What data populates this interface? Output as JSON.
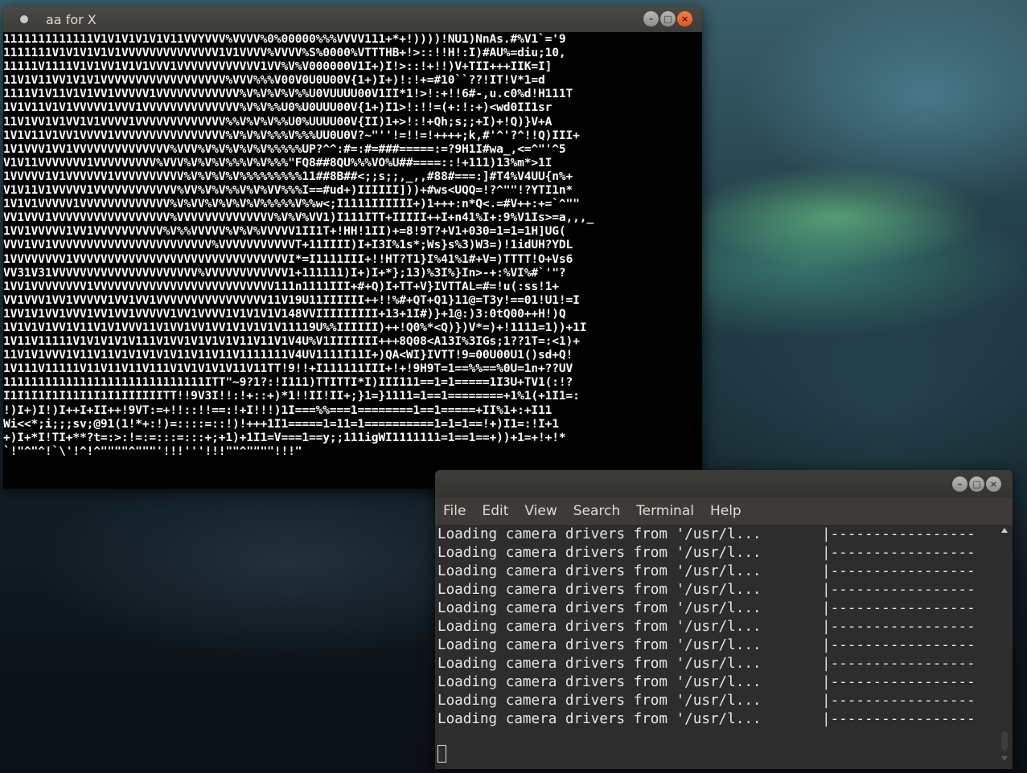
{
  "aa_window": {
    "title": "aa for X",
    "lines": [
      "1111111111111V1V1V1V1V1V11VVYVVV%VVVV%0%00000%%%VVVV111+*+!))))!NU1)NnAs.#%V1`='9",
      "1111111V1V1V1V1V1VVVVVVVVVVVVVV1V1VVVV%VVVV%S%0000%VTTTHB+!>::!!H!:I)#AU%=diu;10,",
      "11111V1111V1V1VV1V1V1VVV1VVVVVVVVVVVV1VV%V%V000000V1I+)I!>::!+!!)V+TII+++IIK=I]",
      "11V1V11VV1V1V1VVVVVVVVVVVVVVVVVV%VVV%%%V00V0U0U00V{1+)I+)!:!+=#10``??!IT!V*1=d",
      "1111V1V11V1V1VV1VVVVV1VVVVVVVVVVVV%V%V%V%V%%U0VUUUU00V1II*1!>!:+!!6#-,u.c0%d!H111T",
      "1V1V11V1V1VVVVV1VVV1VVVVVVVVVVVVVV%V%V%%U0%U0UUU00V{1+)I1>!:!!=(+:!:+)<wd0II1sr",
      "11V1VV1V1VV1V1VVVV1VVVVVVVVVVVVV%%V%V%V%%U0%UUUU00V{II)1+>!:!+Qh;s;;+I)+!Q)}V+A",
      "1V1V11V1VV1VVVV1VVVVVVVVVVVVVVVV%V%V%V%%%V%%%UU0U0V?~\"''!=!!=!++++;k,#'^'?^!!Q)III+",
      "1V1VVV1VV1VVVVVVVVVVVVVV%VVV%V%V%V%V%V%%%%%UP?^^:#=:#=###=====:=?9H1I#wa_,<=^\"'^5",
      "V1V11VVVVVVV1VVVVVVVVV%VVV%V%V%V%%%V%V%%%\"FQ8##8QU%%%VO%U##====::!+111)13%m*>1I",
      "1VVVVV1V1VVVVVV1VVVVVVVVVV%V%V%V%V%%%%%%%%%11##8B##<;;s;;,_,,#88#===:]#T4%V4UU{n%+",
      "V1V11V1VVVVV1VVVVVVVVVVVV%VV%V%V%%V%V%VV%%%I==#ud+)IIIIII]))+#ws<UQQ=!?^\"\"!?YTI1n*",
      "1V1V1VVVVV1VVVVVVVVVVVVV%V%VV%V%V%V%V%%%%%V%%w<;I1111IIIIII+)1+++:n*Q<.=#V++:+=`^\"\"",
      "VV1VVV1VVVVVVVVVVVVVVVVV%VVVVVVVVVVVVVV%V%V%VV1)I111ITT+IIIII++I+n41%I+:9%V1Is>=a,,,_",
      "1VV1VVVVV1VV1VVVVVVVVVV%V%%VVVVV%V%V%VVVVV1II1T+!HH!1II)+=8!9T?+V1+030=1=1=1H]UG(",
      "VVV1VV1VVVVVVVVVVVVVVVVVVVVVVV%VVVVVVVVVVVT+11IIII)I+I3I%1s*;Ws}s%3)W3=)!1idUH?YDL",
      "1VVVVVVVV1VVVVVVVVVVVVVVVVVVVVVVVVVVVVVVVI*=I1111III+!!HT?T1}I%41%1#+V=)TTTT!O+Vs6",
      "VV31V31VVVVVVVVVVVVVVVVVVVVV%VVVVVVVVVVVV1+111111)I+)I+*};13)%3I%}In>-+:%VI%#`'\"?",
      "1VV1VVVVVVVV1VVVVVVVVVVVVVVVVVVVVVVVVVV111n1111III+#+Q)I+TT+V}IVTTAL=#=!u(:ss!1+",
      "VV1VVV1VV1VVVVV1VV1VV1VVVVVVVVVVVVVVVV11V19U11IIIIII++!!%#+QT+Q1}11@=T3y!==01!U1!=I",
      "1VV1V1VV1VVV1VV1VV1VVVVV1VV1VVVV1V1V1V1V148VVIIIIIIIII+13+1I#)}+1@:)3:0tQ00++H!)Q",
      "1V1V1V1VV1V11V1V1VVV11V1VV1VV1VV1V1V1V1V11119U%%IIIIII)++!Q0%*<Q)})V*=)+!1111=1))+1I",
      "1V11V11111V1V1V1V1V111V1VV1V1V1V1V11V11V1V4U%V1IIIIIII+++8Q08<A13I%3IGs;1??1T=:<1)+",
      "11V1V1VVV1V11V11V1V1V1V1V11V11V11V1111111V4UV1111I11I+)QA<WI}IVTT!9=00U00U1()sd+Q!",
      "1V111V11111V11V11V11V111V1V1V1V1V11V11TT!9!!+I111111III+!+!9H9T=1==%%==%0U=1n+??UV",
      "11111111111111111111111111111ITT\"~9?1?:!I111)TTITTI*I)III111==1=1=====1I3U+TV1(:!?",
      "I1I1I1I1I11I1I1I1IIIIIITT!!9V3I!!:!+::+)*1!!II!II+;}1=}1111=1==1========+1%1(+1I1=:",
      "!)I+)I!)I++I+II++!9VT:=+!!::!!==:!+I!!!)1I===%%===1========1==1=====+II%1+:+I11",
      "Wi<<*;i;;;sv;@91(1!*+:!)=::::=::!)!+++1I1=====1=11=1==========1=1=1==!+)I1=:!I+1",
      "+)I+*I!TI+**?t=:>:!=:=:::=:::+;+1)+1I1=V===1==y;;111igWI1111111=1==1==+))+1=+!+!*",
      "`!\"^\"^!`\\'!^!^\"\"\"\"^\"\"\"'!!!'''!!!\"\"^\"\"\"\"!!!\""
    ]
  },
  "terminal": {
    "title": "",
    "menu": [
      "File",
      "Edit",
      "View",
      "Search",
      "Terminal",
      "Help"
    ],
    "lines": [
      {
        "text": "Loading camera drivers from '/usr/l...",
        "bar": "|-----------------"
      },
      {
        "text": "Loading camera drivers from '/usr/l...",
        "bar": "|-----------------"
      },
      {
        "text": "Loading camera drivers from '/usr/l...",
        "bar": "|-----------------"
      },
      {
        "text": "Loading camera drivers from '/usr/l...",
        "bar": "|-----------------"
      },
      {
        "text": "Loading camera drivers from '/usr/l...",
        "bar": "|-----------------"
      },
      {
        "text": "Loading camera drivers from '/usr/l...",
        "bar": "|-----------------"
      },
      {
        "text": "Loading camera drivers from '/usr/l...",
        "bar": "|-----------------"
      },
      {
        "text": "Loading camera drivers from '/usr/l...",
        "bar": "|-----------------"
      },
      {
        "text": "Loading camera drivers from '/usr/l...",
        "bar": "|-----------------"
      },
      {
        "text": "Loading camera drivers from '/usr/l...",
        "bar": "|-----------------"
      },
      {
        "text": "Loading camera drivers from '/usr/l...",
        "bar": "|-----------------"
      }
    ]
  },
  "window_controls": {
    "minimize_glyph": "–",
    "maximize_glyph": "□",
    "close_glyph": "×"
  },
  "colors": {
    "ubuntu_close": "#e95420",
    "titlebar": "#3c3b37",
    "terminal_bg": "#2d2d2d"
  }
}
